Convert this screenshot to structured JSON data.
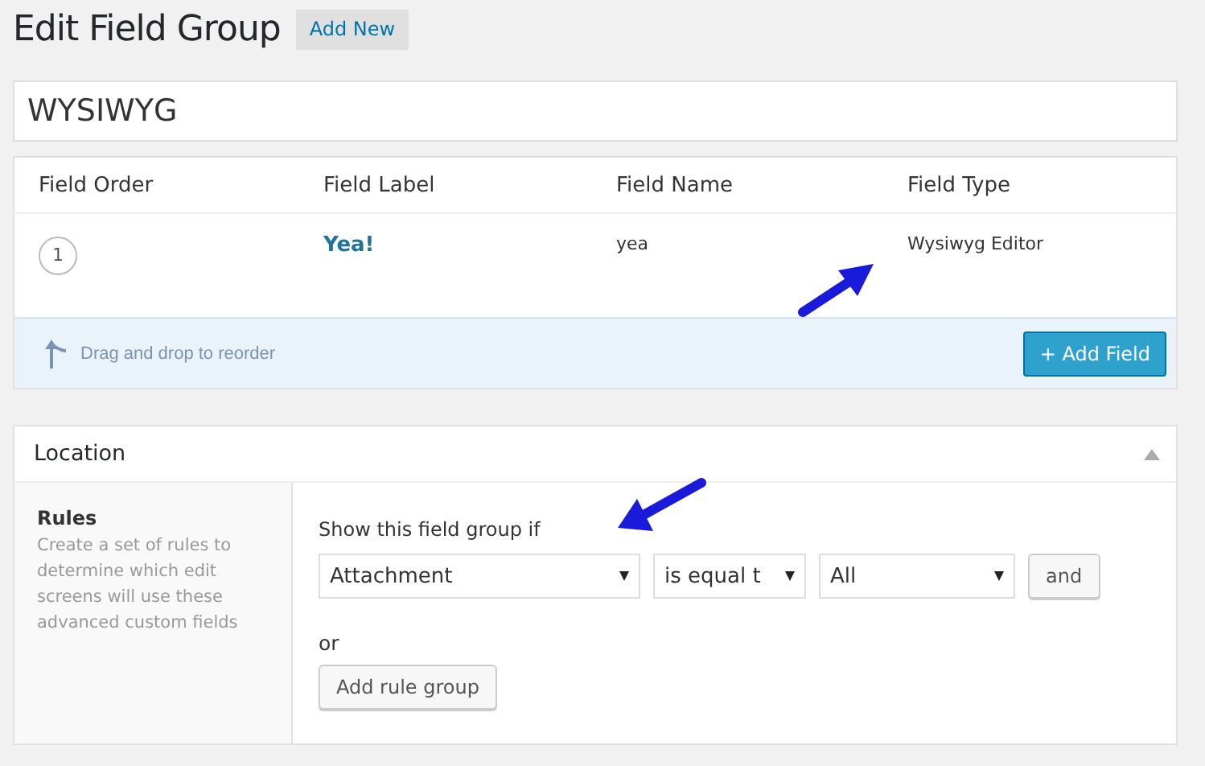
{
  "page": {
    "title": "Edit Field Group",
    "add_new": "Add New"
  },
  "field_group_title": {
    "value": "WYSIWYG"
  },
  "fields_table": {
    "columns": [
      "Field Order",
      "Field Label",
      "Field Name",
      "Field Type"
    ],
    "rows": [
      {
        "order": "1",
        "label": "Yea!",
        "name": "yea",
        "type": "Wysiwyg Editor"
      }
    ],
    "footer_hint": "Drag and drop to reorder",
    "add_button": "+ Add Field"
  },
  "location": {
    "title": "Location",
    "expanded": true,
    "rules_label": "Rules",
    "rules_description": "Create a set of rules to determine which edit screens will use these advanced custom fields",
    "condition_label": "Show this field group if",
    "rule": [
      {
        "kind": "select",
        "value": "Attachment"
      },
      {
        "kind": "select",
        "value": "is equal t"
      },
      {
        "kind": "select",
        "value": "All"
      },
      {
        "kind": "button",
        "value": "and"
      }
    ],
    "or_label": "or",
    "add_group_button": "Add rule group"
  }
}
